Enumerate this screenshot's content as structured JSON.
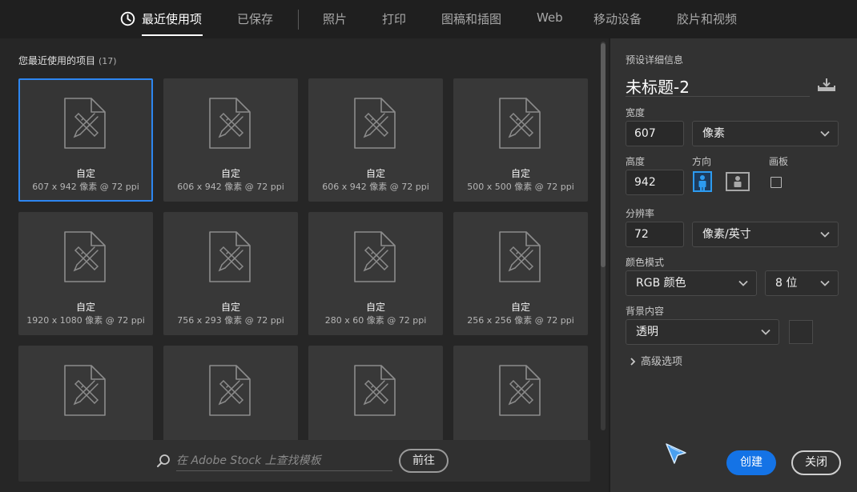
{
  "tabs": [
    {
      "label": "最近使用项",
      "active": true
    },
    {
      "label": "已保存"
    },
    {
      "label": "照片"
    },
    {
      "label": "打印"
    },
    {
      "label": "图稿和插图"
    },
    {
      "label": "Web"
    },
    {
      "label": "移动设备"
    },
    {
      "label": "胶片和视频"
    }
  ],
  "recent": {
    "heading": "您最近使用的项目",
    "count": "(17)",
    "items": [
      {
        "name": "自定",
        "size": "607 x 942 像素 @ 72 ppi",
        "selected": true
      },
      {
        "name": "自定",
        "size": "606 x 942 像素 @ 72 ppi"
      },
      {
        "name": "自定",
        "size": "606 x 942 像素 @ 72 ppi"
      },
      {
        "name": "自定",
        "size": "500 x 500 像素 @ 72 ppi"
      },
      {
        "name": "自定",
        "size": "1920 x 1080 像素 @ 72 ppi"
      },
      {
        "name": "自定",
        "size": "756 x 293 像素 @ 72 ppi"
      },
      {
        "name": "自定",
        "size": "280 x 60 像素 @ 72 ppi"
      },
      {
        "name": "自定",
        "size": "256 x 256 像素 @ 72 ppi"
      },
      {
        "name": "",
        "size": ""
      },
      {
        "name": "",
        "size": ""
      },
      {
        "name": "",
        "size": ""
      },
      {
        "name": "",
        "size": ""
      }
    ]
  },
  "search": {
    "placeholder": "在 Adobe Stock 上查找模板",
    "go_label": "前往"
  },
  "preset": {
    "heading": "预设详细信息",
    "title": "未标题-2",
    "width_label": "宽度",
    "width_value": "607",
    "unit": "像素",
    "height_label": "高度",
    "height_value": "942",
    "orientation_label": "方向",
    "artboard_label": "画板",
    "resolution_label": "分辨率",
    "resolution_value": "72",
    "resolution_unit": "像素/英寸",
    "color_mode_label": "颜色模式",
    "color_mode": "RGB 颜色",
    "bit_depth": "8 位",
    "background_label": "背景内容",
    "background": "透明",
    "advanced_label": "高级选项",
    "create_label": "创建",
    "close_label": "关闭"
  },
  "colors": {
    "accent": "#1473e6",
    "selection": "#2d86f0",
    "orientation_active": "#2d9bf0"
  }
}
